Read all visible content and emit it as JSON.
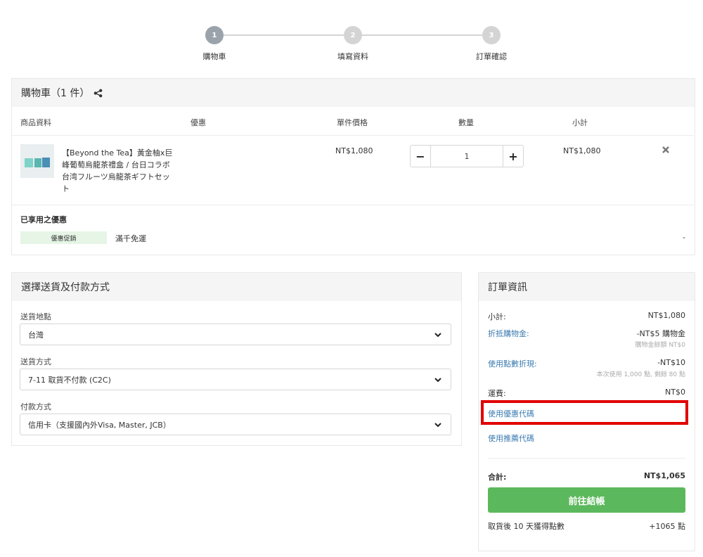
{
  "steps": [
    {
      "number": "1",
      "label": "購物車"
    },
    {
      "number": "2",
      "label": "填寫資料"
    },
    {
      "number": "3",
      "label": "訂單確認"
    }
  ],
  "colors": {
    "step_active": "#9aa3ab",
    "step_inactive": "#d4d4d4",
    "checkout_button": "#5cb85c",
    "highlight_box": "#e10000",
    "link": "#3a7bb0",
    "promo_badge_bg": "#e6f5e6"
  },
  "cart": {
    "title": "購物車（1 件）",
    "share_icon": "share-icon",
    "columns": {
      "product": "商品資料",
      "discount": "優惠",
      "unit_price": "單件價格",
      "quantity": "數量",
      "subtotal": "小計"
    },
    "items": [
      {
        "name": "【Beyond the Tea】黃金柚x巨峰葡萄烏龍茶禮盒 / 台日コラボ台湾フルーツ烏龍茶ギフトセット",
        "unit_price": "NT$1,080",
        "quantity": "1",
        "subtotal": "NT$1,080",
        "minus_label": "−",
        "plus_label": "+",
        "remove_icon": "close-icon"
      }
    ],
    "applied_title": "已享用之優惠",
    "promo_badge": "優惠促銷",
    "promo_text": "滿千免運",
    "promo_value": "-"
  },
  "shipping": {
    "title": "選擇送貨及付款方式",
    "location_label": "送貨地點",
    "location_value": "台灣",
    "method_label": "送貨方式",
    "method_value": "7-11 取貨不付款 (C2C)",
    "payment_label": "付款方式",
    "payment_value": "信用卡（支援國內外Visa, Master, JCB）"
  },
  "order": {
    "title": "訂單資訊",
    "subtotal_label": "小計:",
    "subtotal_value": "NT$1,080",
    "credit_label": "折抵購物金:",
    "credit_value": "-NT$5 購物金",
    "credit_note": "購物金餘額 NT$0",
    "points_label": "使用點數折現:",
    "points_value": "-NT$10",
    "points_note": "本次使用 1,000 點, 剩餘 80 點",
    "shipping_label": "運費:",
    "shipping_value": "NT$0",
    "coupon_link": "使用優惠代碼",
    "referral_link": "使用推薦代碼",
    "total_label": "合計:",
    "total_value": "NT$1,065",
    "checkout_button": "前往結帳",
    "reward_label": "取貨後 10 天獲得點數",
    "reward_value": "+1065 點"
  }
}
